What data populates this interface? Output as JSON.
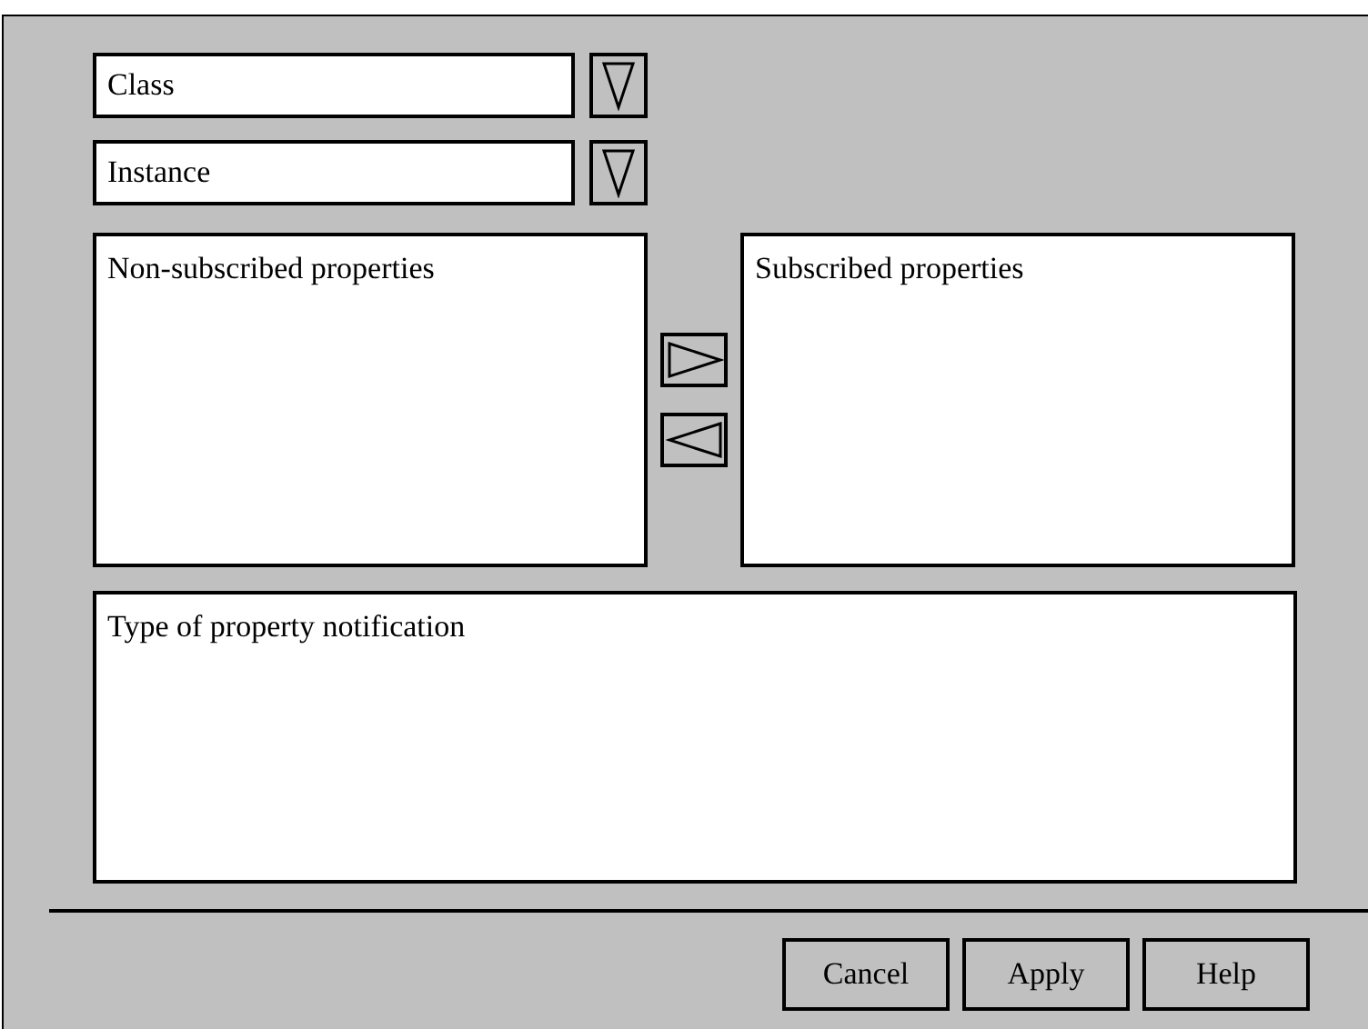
{
  "selectors": [
    {
      "value": "Class"
    },
    {
      "value": "Instance"
    }
  ],
  "lists": [
    {
      "title": "Non-subscribed properties"
    },
    {
      "title": "Subscribed properties"
    }
  ],
  "notification": {
    "title": "Type of property notification"
  },
  "buttons": [
    "Cancel",
    "Apply",
    "Help"
  ]
}
